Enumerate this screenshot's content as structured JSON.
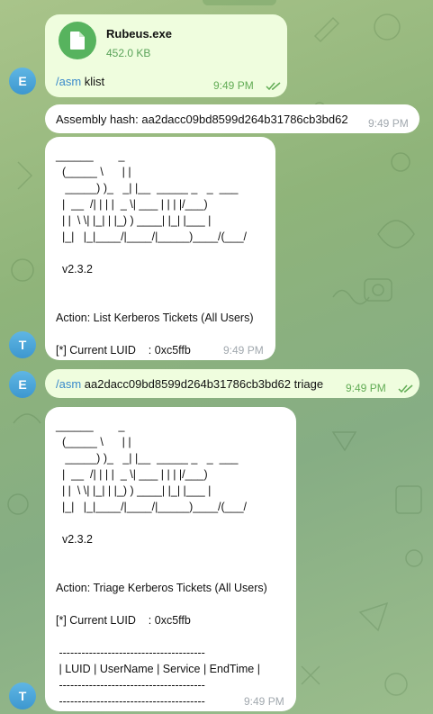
{
  "chat": {
    "file_msg": {
      "file_name": "Rubeus.exe",
      "file_size": "452.0 KB",
      "command": "/asm",
      "text": " klist",
      "time": "9:49 PM",
      "avatar_letter": "E"
    },
    "hash_msg": {
      "text": "Assembly hash: aa2dacc09bd8599d264b31786cb3bd62",
      "time": "9:49 PM"
    },
    "klist_result": {
      "lines": [
        "______        _",
        "  (_____ \\      | |",
        "   _____) )_   _| |__  _____ _   _  ___",
        "  |  __  /| | | |  _ \\| ___ | | | |/___)",
        "  | |  \\ \\| |_| | |_) ) ____| |_| |___ |",
        "  |_|   |_|____/|____/|_____)____/(___/",
        "",
        "  v2.3.2",
        "",
        "",
        "Action: List Kerberos Tickets (All Users)",
        "",
        "[*] Current LUID    : 0xc5ffb"
      ],
      "time": "9:49 PM",
      "avatar_letter": "T"
    },
    "triage_msg": {
      "command": "/asm",
      "text": " aa2dacc09bd8599d264b31786cb3bd62 triage",
      "time": "9:49 PM",
      "avatar_letter": "E"
    },
    "triage_result": {
      "lines": [
        "______        _",
        "  (_____ \\      | |",
        "   _____) )_   _| |__  _____ _   _  ___",
        "  |  __  /| | | |  _ \\| ___ | | | |/___)",
        "  | |  \\ \\| |_| | |_) ) ____| |_| |___ |",
        "  |_|   |_|____/|____/|_____)____/(___/",
        "",
        "  v2.3.2",
        "",
        "",
        "Action: Triage Kerberos Tickets (All Users)",
        "",
        "[*] Current LUID    : 0xc5ffb",
        "",
        " ---------------------------------------",
        " | LUID | UserName | Service | EndTime |",
        " ---------------------------------------",
        " ---------------------------------------"
      ],
      "time": "9:49 PM",
      "avatar_letter": "T"
    }
  },
  "colors": {
    "outgoing_bubble": "#effdde",
    "incoming_bubble": "#ffffff",
    "command_link": "#3a8acb",
    "file_icon": "#57b35e",
    "avatar": "#4aa6dc"
  },
  "icons": [
    "file-icon",
    "double-check-icon"
  ]
}
